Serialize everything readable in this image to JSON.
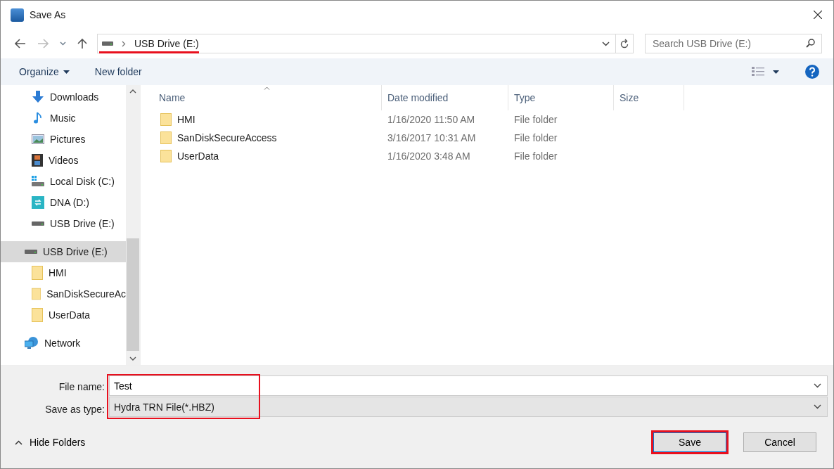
{
  "window": {
    "title": "Save As"
  },
  "address": {
    "crumb": "USB Drive (E:)",
    "highlighted": true
  },
  "search": {
    "placeholder": "Search USB Drive (E:)"
  },
  "toolbar": {
    "organize": "Organize",
    "new_folder": "New folder"
  },
  "sidebar": {
    "items": [
      {
        "label": "Downloads",
        "kind": "downloads",
        "selected": false
      },
      {
        "label": "Music",
        "kind": "music",
        "selected": false
      },
      {
        "label": "Pictures",
        "kind": "pictures",
        "selected": false
      },
      {
        "label": "Videos",
        "kind": "videos",
        "selected": false
      },
      {
        "label": "Local Disk (C:)",
        "kind": "disk",
        "selected": false
      },
      {
        "label": "DNA (D:)",
        "kind": "sync",
        "selected": false
      },
      {
        "label": "USB Drive (E:)",
        "kind": "drive",
        "selected": false
      },
      {
        "label": "USB Drive (E:)",
        "kind": "drive-root",
        "selected": true,
        "children": [
          {
            "label": "HMI",
            "kind": "folder",
            "selected": false
          },
          {
            "label": "SanDiskSecureAc",
            "kind": "folder",
            "selected": false
          },
          {
            "label": "UserData",
            "kind": "folder",
            "selected": false
          }
        ]
      },
      {
        "label": "Network",
        "kind": "network",
        "selected": false
      }
    ]
  },
  "table": {
    "columns": [
      "Name",
      "Date modified",
      "Type",
      "Size"
    ],
    "rows": [
      {
        "name": "HMI",
        "date": "1/16/2020 11:50 AM",
        "type": "File folder"
      },
      {
        "name": "SanDiskSecureAccess",
        "date": "3/16/2017 10:31 AM",
        "type": "File folder"
      },
      {
        "name": "UserData",
        "date": "1/16/2020 3:48 AM",
        "type": "File folder"
      }
    ]
  },
  "file_name": {
    "label": "File name:",
    "value": "Test"
  },
  "save_type": {
    "label": "Save as type:",
    "value": "Hydra TRN File(*.HBZ)"
  },
  "fields_highlighted": true,
  "hide_folders": "Hide Folders",
  "buttons": [
    {
      "label": "Save",
      "kind": "primary",
      "highlighted": true
    },
    {
      "label": "Cancel",
      "kind": "normal",
      "highlighted": false
    }
  ]
}
